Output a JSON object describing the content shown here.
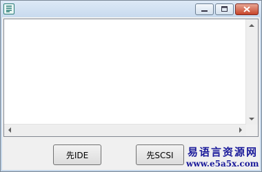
{
  "window": {
    "app_icon": "app-logo-icon",
    "controls": {
      "minimize_icon": "minimize-icon",
      "maximize_icon": "maximize-icon",
      "close_icon": "close-icon"
    }
  },
  "buttons": {
    "ide_label": "先IDE",
    "scsi_label": "先SCSI"
  },
  "watermark": {
    "site_name": "易语言资源网",
    "url": "www.e5a5x.com"
  },
  "colors": {
    "title_bar": "#c8daee",
    "close_button": "#c7452a",
    "watermark_text": "#1a1a9a"
  }
}
